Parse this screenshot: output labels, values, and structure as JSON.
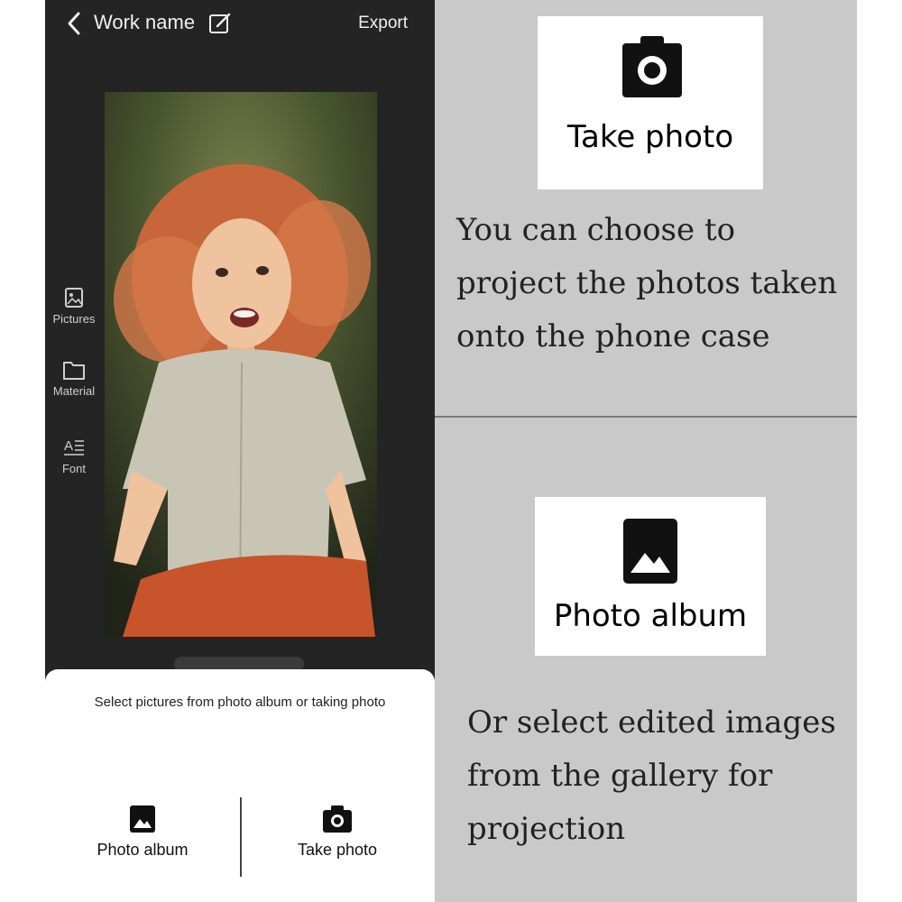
{
  "header": {
    "title": "Work name",
    "export_label": "Export",
    "icons": [
      "back-arrow-icon",
      "edit-icon"
    ]
  },
  "sidebar": {
    "items": [
      {
        "label": "Pictures",
        "icon": "picture-icon"
      },
      {
        "label": "Material",
        "icon": "folder-icon"
      },
      {
        "label": "Font",
        "icon": "font-icon"
      }
    ]
  },
  "sheet": {
    "title": "Select pictures from photo album or taking photo",
    "options": [
      {
        "label": "Photo album",
        "icon": "image-icon"
      },
      {
        "label": "Take photo",
        "icon": "camera-icon"
      }
    ]
  },
  "panels": {
    "top": {
      "card_label": "Take photo",
      "card_icon": "camera-icon",
      "description": "You can choose to project the photos taken onto the phone case"
    },
    "bottom": {
      "card_label": "Photo album",
      "card_icon": "image-icon",
      "description": "Or select edited images from the gallery for projection"
    }
  },
  "colors": {
    "app_background": "#242424",
    "panel_background": "#c9c9c9",
    "sheet_background": "#ffffff"
  }
}
